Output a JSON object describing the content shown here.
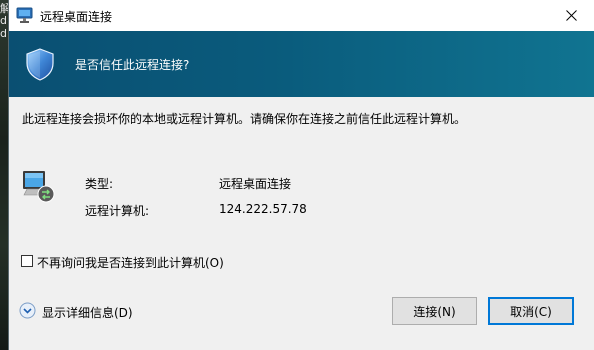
{
  "window": {
    "title": "远程桌面连接"
  },
  "banner": {
    "question": "是否信任此远程连接?"
  },
  "body": {
    "warning": "此远程连接会损坏你的本地或远程计算机。请确保你在连接之前信任此远程计算机。",
    "fields": [
      {
        "label": "类型:",
        "value": "远程桌面连接"
      },
      {
        "label": "远程计算机:",
        "value": "124.222.57.78"
      }
    ]
  },
  "options": {
    "dont_ask_label": "不再询问我是否连接到此计算机(O)",
    "dont_ask_checked": false,
    "details_label": "显示详细信息(D)"
  },
  "buttons": {
    "connect": "连接(N)",
    "cancel": "取消(C)"
  },
  "desktop": {
    "edge_glyphs": [
      "解",
      "d",
      "d"
    ]
  },
  "colors": {
    "banner": "#0a5b7c",
    "dialog_bg": "#f0f0f0",
    "focus_border": "#0078d7"
  }
}
